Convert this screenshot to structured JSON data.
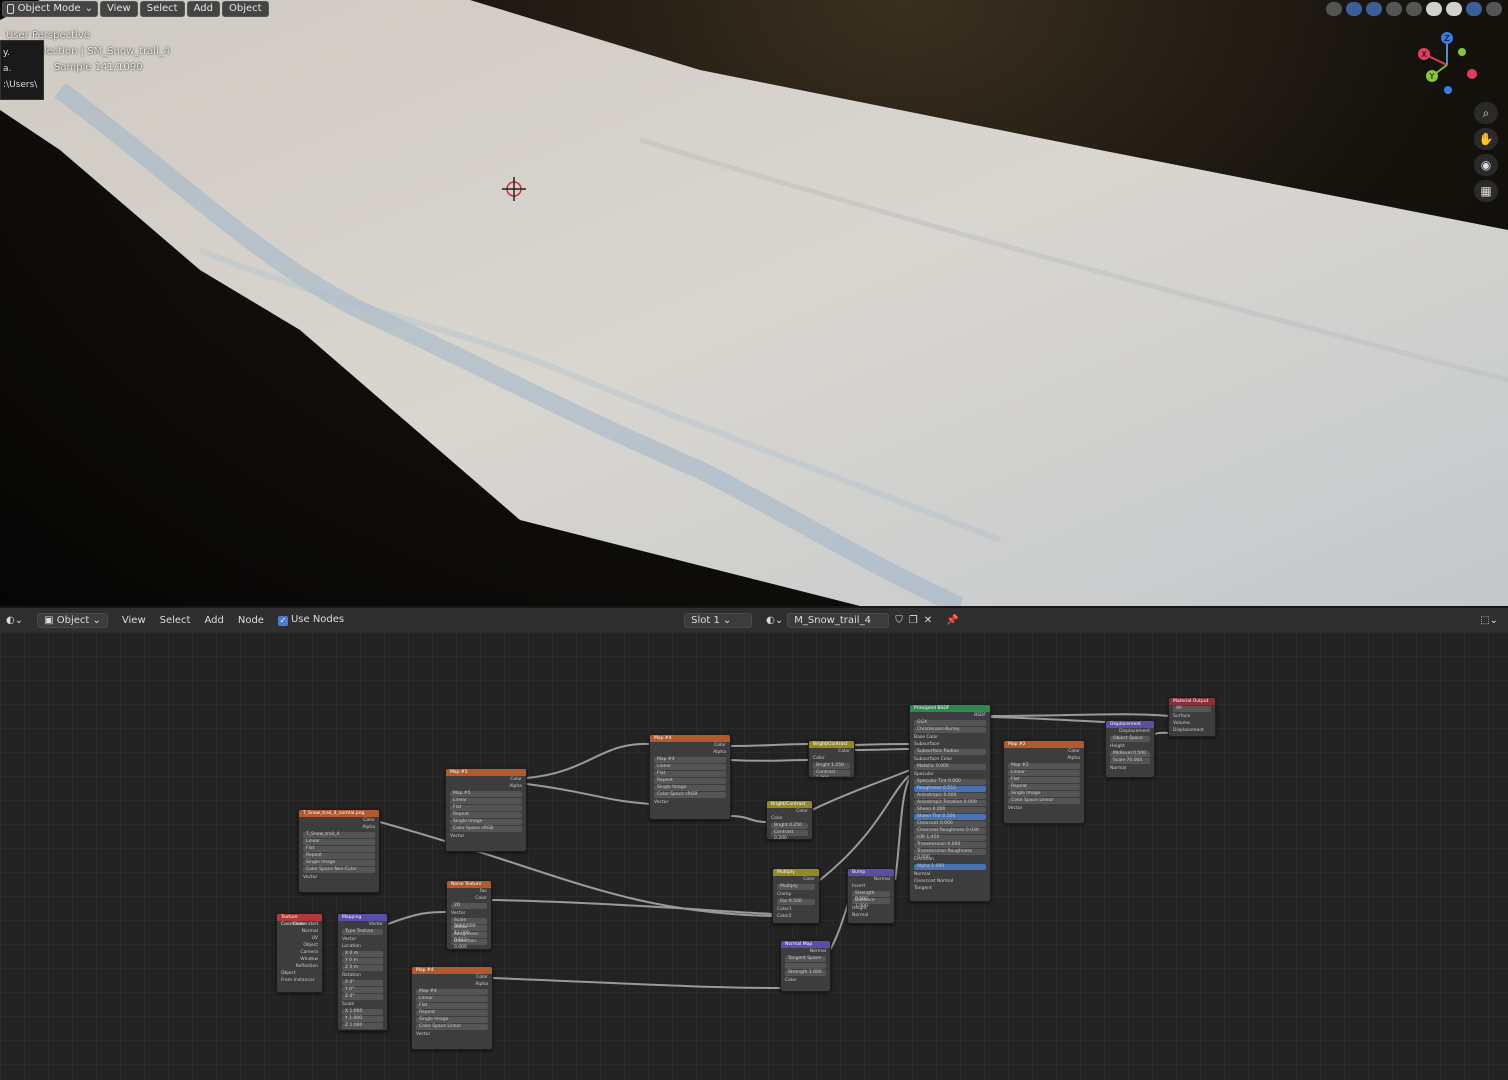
{
  "viewport": {
    "mode": "Object Mode",
    "menu": [
      "View",
      "Select",
      "Add",
      "Object"
    ],
    "overlay": {
      "perspective": "User Perspective",
      "collection": "Collection | SM_Snow_trail_4",
      "sample": "Sample 141/1090"
    },
    "tooltip": {
      "line1": "y.",
      "line2": "a.",
      "path": ":\\Users\\"
    },
    "gizmo": {
      "x": "X",
      "y": "Y",
      "z": "Z"
    }
  },
  "editor_header": {
    "context": "Object",
    "menu": [
      "View",
      "Select",
      "Add",
      "Node"
    ],
    "use_nodes_label": "Use Nodes",
    "slot": "Slot 1",
    "material": "M_Snow_trail_4"
  },
  "nodes": {
    "map1": {
      "title": "Map #5",
      "rows": [
        "Color",
        "Alpha",
        "Map #5",
        "Linear",
        "Flat",
        "Repeat",
        "Single Image",
        "Color Space   sRGB",
        "Vector"
      ]
    },
    "map2": {
      "title": "Map #4",
      "rows": [
        "Color",
        "Alpha",
        "Map #4",
        "Linear",
        "Flat",
        "Repeat",
        "Single Image",
        "Color Space   sRGB",
        "Vector"
      ]
    },
    "map3": {
      "title": "Map #2",
      "rows": [
        "Color",
        "Alpha",
        "Map #2",
        "Linear",
        "Flat",
        "Repeat",
        "Single Image",
        "Color Space   Linear",
        "Vector"
      ]
    },
    "map4": {
      "title": "Map #4",
      "rows": [
        "Color",
        "Alpha",
        "Map #4",
        "Linear",
        "Flat",
        "Repeat",
        "Single Image",
        "Color Space   Linear",
        "Vector"
      ]
    },
    "tex": {
      "title": "T_Snow_trail_4_normal.png",
      "rows": [
        "Color",
        "Alpha",
        "T_Snow_trail_4",
        "Linear",
        "Flat",
        "Repeat",
        "Single Image",
        "Color Space   Non-Color",
        "Vector"
      ]
    },
    "texcoord": {
      "title": "Texture Coordinate",
      "rows": [
        "Generated",
        "Normal",
        "UV",
        "Object",
        "Camera",
        "Window",
        "Reflection",
        "Object",
        "From Instancer"
      ]
    },
    "mapping": {
      "title": "Mapping",
      "rows": [
        "Vector",
        "Type   Texture",
        "Vector",
        "Location",
        "X  0 m",
        "Y  0 m",
        "Z  0 m",
        "Rotation",
        "X  0°",
        "Y  0°",
        "Z  0°",
        "Scale",
        "X  1.000",
        "Y  1.000",
        "Z  1.000"
      ]
    },
    "noise": {
      "title": "Noise Texture",
      "rows": [
        "Fac",
        "Color",
        "2D",
        "Vector",
        "Scale  3000.000",
        "Detail  13.000",
        "Roughness 0.612",
        "Distortion  0.000"
      ]
    },
    "bc1": {
      "title": "Bright/Contrast",
      "rows": [
        "Color",
        "Color",
        "Bright   1.250",
        "Contrast 1.000"
      ]
    },
    "bc2": {
      "title": "Bright/Contrast",
      "rows": [
        "Color",
        "Color",
        "Bright   0.250",
        "Contrast 0.200"
      ]
    },
    "mix": {
      "title": "Multiply",
      "rows": [
        "Color",
        "Multiply",
        "Clamp",
        "Fac  0.500",
        "Color1",
        "Color2"
      ]
    },
    "bump": {
      "title": "Bump",
      "rows": [
        "Normal",
        "Invert",
        "Strength  0.500",
        "Distance  1.000",
        "Height",
        "Normal"
      ]
    },
    "normalmap": {
      "title": "Normal Map",
      "rows": [
        "Normal",
        "Tangent Space",
        "",
        "Strength  1.000",
        "Color"
      ]
    },
    "bsdf": {
      "title": "Principled BSDF",
      "rows": [
        "BSDF",
        "GGX",
        "Christensen-Burley",
        "Base Color",
        "Subsurface",
        "Subsurface Radius",
        "Subsurface Color",
        "Metallic  0.000",
        "Specular",
        "Specular Tint  0.000",
        "Roughness  0.553",
        "Anisotropic  0.000",
        "Anisotropic Rotation 0.000",
        "Sheen  0.000",
        "Sheen Tint  0.500",
        "Clearcoat  0.000",
        "Clearcoat Roughness 0.030",
        "IOR  1.450",
        "Transmission  0.000",
        "Transmission Roughness 0.000",
        "Emission",
        "Alpha  1.000",
        "Normal",
        "Clearcoat Normal",
        "Tangent"
      ]
    },
    "disp": {
      "title": "Displacement",
      "rows": [
        "Displacement",
        "Object Space",
        "Height",
        "Midlevel  0.500",
        "Scale  70.000",
        "Normal"
      ]
    },
    "output": {
      "title": "Material Output",
      "rows": [
        "All",
        "Surface",
        "Volume",
        "Displacement"
      ]
    }
  }
}
